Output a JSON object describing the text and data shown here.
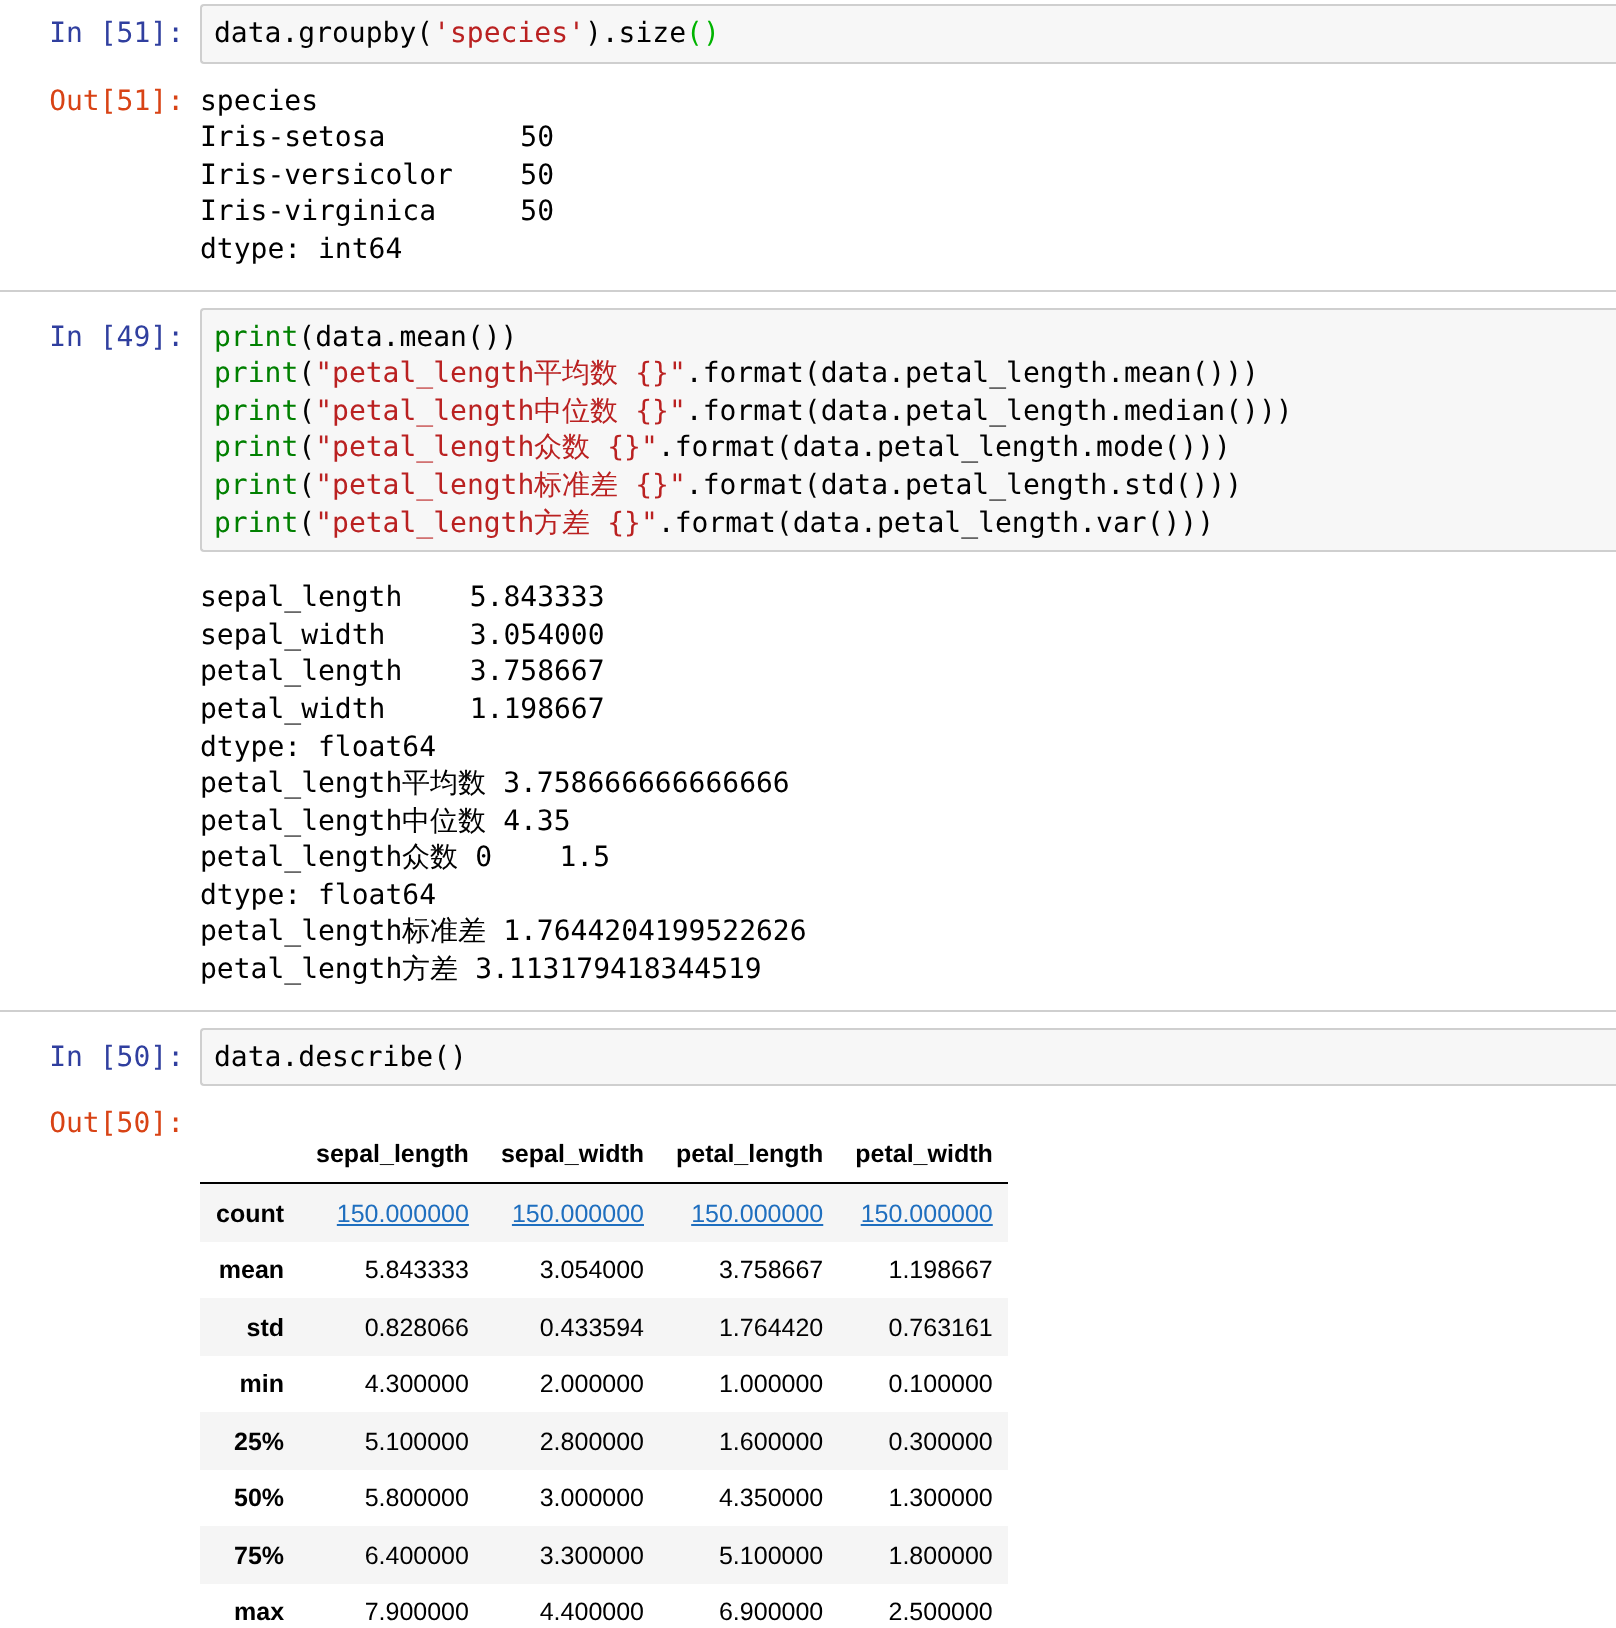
{
  "cells": [
    {
      "input_prompt": "In [51]:",
      "code": [
        [
          {
            "kind": "plain",
            "text": "data.groupby("
          },
          {
            "kind": "string",
            "text": "'species'"
          },
          {
            "kind": "plain",
            "text": ").size"
          },
          {
            "kind": "match",
            "text": "()"
          }
        ]
      ],
      "output": {
        "kind": "text",
        "prompt": "Out[51]:",
        "lines": [
          "species",
          "Iris-setosa        50",
          "Iris-versicolor    50",
          "Iris-virginica     50",
          "dtype: int64"
        ]
      }
    },
    {
      "input_prompt": "In [49]:",
      "code": [
        [
          {
            "kind": "builtin",
            "text": "print"
          },
          {
            "kind": "plain",
            "text": "(data.mean())"
          }
        ],
        [
          {
            "kind": "builtin",
            "text": "print"
          },
          {
            "kind": "plain",
            "text": "("
          },
          {
            "kind": "string",
            "text": "\"petal_length平均数 {}\""
          },
          {
            "kind": "plain",
            "text": ".format(data.petal_length.mean()))"
          }
        ],
        [
          {
            "kind": "builtin",
            "text": "print"
          },
          {
            "kind": "plain",
            "text": "("
          },
          {
            "kind": "string",
            "text": "\"petal_length中位数 {}\""
          },
          {
            "kind": "plain",
            "text": ".format(data.petal_length.median()))"
          }
        ],
        [
          {
            "kind": "builtin",
            "text": "print"
          },
          {
            "kind": "plain",
            "text": "("
          },
          {
            "kind": "string",
            "text": "\"petal_length众数 {}\""
          },
          {
            "kind": "plain",
            "text": ".format(data.petal_length.mode()))"
          }
        ],
        [
          {
            "kind": "builtin",
            "text": "print"
          },
          {
            "kind": "plain",
            "text": "("
          },
          {
            "kind": "string",
            "text": "\"petal_length标准差 {}\""
          },
          {
            "kind": "plain",
            "text": ".format(data.petal_length.std()))"
          }
        ],
        [
          {
            "kind": "builtin",
            "text": "print"
          },
          {
            "kind": "plain",
            "text": "("
          },
          {
            "kind": "string",
            "text": "\"petal_length方差 {}\""
          },
          {
            "kind": "plain",
            "text": ".format(data.petal_length.var()))"
          }
        ]
      ],
      "output": {
        "kind": "text",
        "lines": [
          "sepal_length    5.843333",
          "sepal_width     3.054000",
          "petal_length    3.758667",
          "petal_width     1.198667",
          "dtype: float64",
          "petal_length平均数 3.758666666666666",
          "petal_length中位数 4.35",
          "petal_length众数 0    1.5",
          "dtype: float64",
          "petal_length标准差 1.7644204199522626",
          "petal_length方差 3.113179418344519"
        ]
      }
    },
    {
      "input_prompt": "In [50]:",
      "code": [
        [
          {
            "kind": "plain",
            "text": "data.describe()"
          }
        ]
      ],
      "output": {
        "kind": "table",
        "prompt": "Out[50]:",
        "columns": [
          "sepal_length",
          "sepal_width",
          "petal_length",
          "petal_width"
        ],
        "rows": [
          {
            "index": "count",
            "link": true,
            "values": [
              "150.000000",
              "150.000000",
              "150.000000",
              "150.000000"
            ]
          },
          {
            "index": "mean",
            "link": false,
            "values": [
              "5.843333",
              "3.054000",
              "3.758667",
              "1.198667"
            ]
          },
          {
            "index": "std",
            "link": false,
            "values": [
              "0.828066",
              "0.433594",
              "1.764420",
              "0.763161"
            ]
          },
          {
            "index": "min",
            "link": false,
            "values": [
              "4.300000",
              "2.000000",
              "1.000000",
              "0.100000"
            ]
          },
          {
            "index": "25%",
            "link": false,
            "values": [
              "5.100000",
              "2.800000",
              "1.600000",
              "0.300000"
            ]
          },
          {
            "index": "50%",
            "link": false,
            "values": [
              "5.800000",
              "3.000000",
              "4.350000",
              "1.300000"
            ]
          },
          {
            "index": "75%",
            "link": false,
            "values": [
              "6.400000",
              "3.300000",
              "5.100000",
              "1.800000"
            ]
          },
          {
            "index": "max",
            "link": false,
            "values": [
              "7.900000",
              "4.400000",
              "6.900000",
              "2.500000"
            ]
          }
        ]
      }
    }
  ]
}
